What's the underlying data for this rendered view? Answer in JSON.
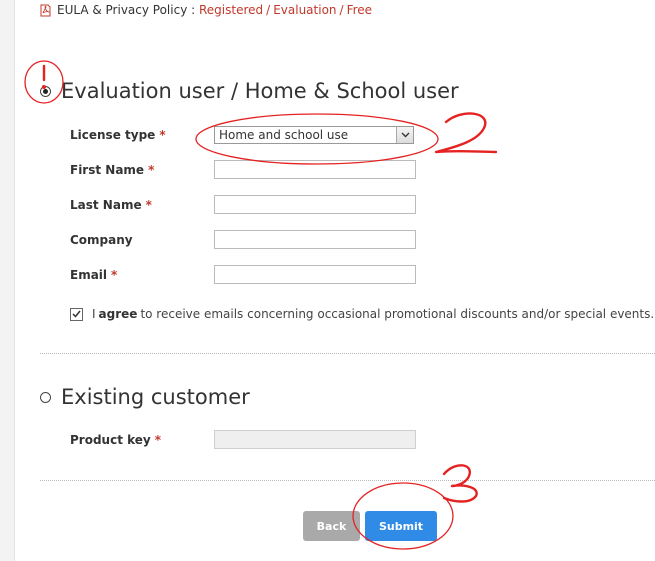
{
  "eula": {
    "prefix": "EULA & Privacy Policy :",
    "links": [
      "Registered",
      "Evaluation",
      "Free"
    ],
    "separator": "/"
  },
  "evaluation": {
    "title": "Evaluation user / Home & School user",
    "selected": true,
    "license_type": {
      "label": "License type",
      "value": "Home and school use"
    },
    "first_name": {
      "label": "First Name",
      "value": ""
    },
    "last_name": {
      "label": "Last Name",
      "value": ""
    },
    "company": {
      "label": "Company",
      "value": ""
    },
    "email": {
      "label": "Email",
      "value": ""
    },
    "agree": {
      "checked": true,
      "prefix": "I",
      "bold": "agree",
      "suffix": "to receive emails concerning occasional promotional discounts and/or special events."
    }
  },
  "existing": {
    "title": "Existing customer",
    "selected": false,
    "product_key": {
      "label": "Product key",
      "value": ""
    }
  },
  "buttons": {
    "back": "Back",
    "submit": "Submit"
  },
  "required_mark": "*",
  "annotations": {
    "one": "!",
    "two": "2",
    "three": "3",
    "color": "#e52222"
  },
  "colors": {
    "link": "#c0392b",
    "submit": "#2f8be6",
    "back": "#a9a9a9"
  }
}
